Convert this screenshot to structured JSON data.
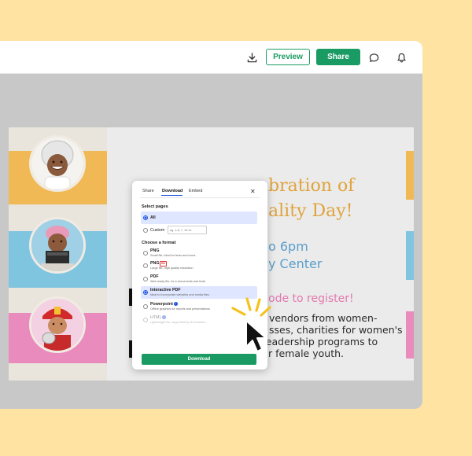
{
  "toolbar": {
    "preview_label": "Preview",
    "share_label": "Share",
    "icons": [
      "download-icon",
      "comment-icon",
      "bell-icon"
    ]
  },
  "flyer": {
    "title_line1": "bration of",
    "title_line2": "ality Day!",
    "time_fragment": "o 6pm",
    "venue_fragment": "y Center",
    "register_text": "ode to register!",
    "body_lines": [
      "vendors from women-",
      "sses, charities for women's",
      "rights, and leadership programs to",
      "empower our female youth."
    ],
    "colors": {
      "band_orange": "#f0b955",
      "band_blue": "#7fc5df",
      "band_pink": "#ea8bbd",
      "title_orange": "#e0a33c",
      "event_blue": "#5a9ecb",
      "register_pink": "#e27aaf"
    }
  },
  "dialog": {
    "tabs": [
      "Share",
      "Download",
      "Embed"
    ],
    "active_tab": "Download",
    "select_pages_title": "Select pages",
    "pages_options": [
      {
        "label": "All",
        "selected": true
      },
      {
        "label": "Custom",
        "selected": false,
        "placeholder": "eg. 1-6, 7, 10-11"
      }
    ],
    "choose_format_title": "Choose a format",
    "formats": [
      {
        "name": "PNG",
        "desc": "Small file, ideal for texts and icons",
        "selected": false,
        "badge": ""
      },
      {
        "name": "PNG",
        "desc": "Large file, high quality resolution",
        "selected": false,
        "badge": "HD"
      },
      {
        "name": "PDF",
        "desc": "Web ready file, for e-documents and texts",
        "selected": false,
        "badge": ""
      },
      {
        "name": "Interactive PDF",
        "desc": "Ideal to incorporate websites and media files",
        "selected": true,
        "badge": ""
      },
      {
        "name": "Powerpoint",
        "desc": "Offline graphics for reports and presentations",
        "selected": false,
        "badge": ""
      },
      {
        "name": "HTML",
        "desc": "Lightweight file, supported by all browsers",
        "selected": false,
        "badge": ""
      }
    ],
    "download_label": "Download",
    "accent": "#1a9b64"
  }
}
